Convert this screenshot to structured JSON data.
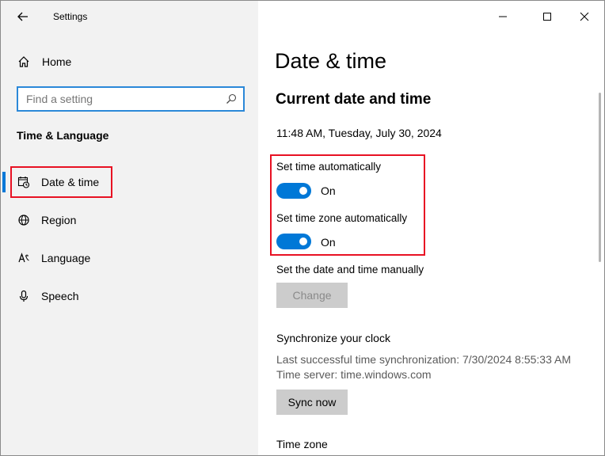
{
  "window": {
    "app_title": "Settings"
  },
  "sidebar": {
    "home_label": "Home",
    "search_placeholder": "Find a setting",
    "section_heading": "Time & Language",
    "items": [
      {
        "label": "Date & time",
        "icon": "calendar-clock-icon",
        "active": true
      },
      {
        "label": "Region",
        "icon": "globe-icon"
      },
      {
        "label": "Language",
        "icon": "language-icon"
      },
      {
        "label": "Speech",
        "icon": "microphone-icon"
      }
    ]
  },
  "main": {
    "page_title": "Date & time",
    "section_title": "Current date and time",
    "current_datetime": "11:48 AM, Tuesday, July 30, 2024",
    "auto_time": {
      "label": "Set time automatically",
      "state": "On"
    },
    "auto_timezone": {
      "label": "Set time zone automatically",
      "state": "On"
    },
    "manual": {
      "label": "Set the date and time manually",
      "button": "Change"
    },
    "sync": {
      "heading": "Synchronize your clock",
      "last_sync": "Last successful time synchronization: 7/30/2024 8:55:33 AM",
      "server": "Time server: time.windows.com",
      "button": "Sync now"
    },
    "timezone_heading": "Time zone"
  },
  "colors": {
    "accent": "#0078d7",
    "highlight": "#e81123",
    "sidebar_bg": "#f2f2f2",
    "button_gray": "#cccccc"
  }
}
